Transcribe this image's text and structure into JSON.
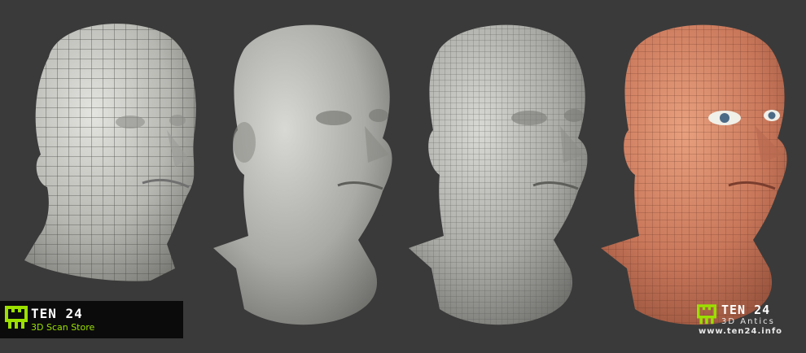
{
  "image": {
    "description_items": [
      "wireframe-head",
      "sculpt-head",
      "wire-sculpt-head",
      "textured-head"
    ]
  },
  "badge_left": {
    "title": "TEN 24",
    "subtitle": "3D Scan Store",
    "accent_color": "#9be000"
  },
  "badge_right": {
    "title": "TEN 24",
    "subtitle": "3D Antics",
    "url": "www.ten24.info",
    "accent_color": "#9be000"
  }
}
